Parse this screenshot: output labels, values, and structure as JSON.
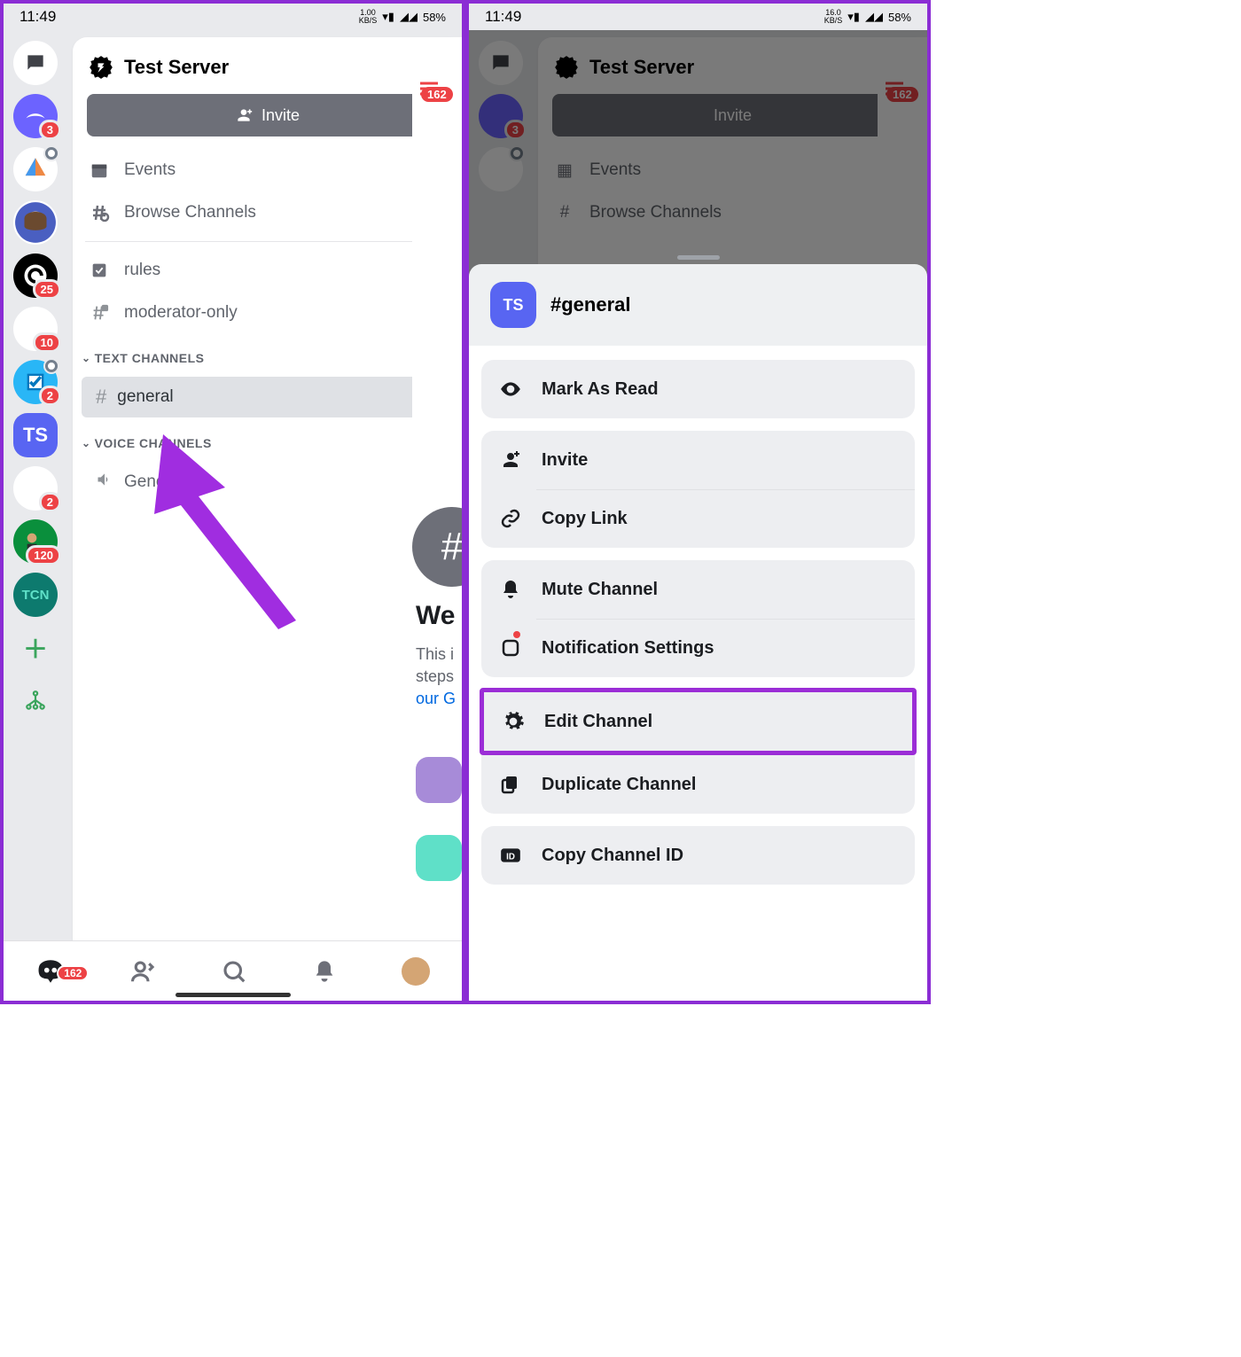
{
  "status": {
    "time": "11:49",
    "kbs_left": "1.00",
    "kbs_right": "16.0",
    "kbs_unit": "KB/S",
    "battery": "58%"
  },
  "server": {
    "name": "Test Server",
    "invite_label": "Invite",
    "rows": {
      "events": "Events",
      "browse": "Browse Channels",
      "rules": "rules",
      "mod": "moderator-only"
    },
    "categories": {
      "text": "TEXT CHANNELS",
      "voice": "VOICE CHANNELS"
    },
    "channels": {
      "general": "general",
      "general_voice": "General"
    }
  },
  "rail": {
    "ts_label": "TS",
    "badges": {
      "b1": "3",
      "b2": "25",
      "b3": "10",
      "b4": "2",
      "b5": "2",
      "b6": "120"
    }
  },
  "peek": {
    "badge": "162",
    "welcome": "We",
    "sub1": "This i",
    "sub2": "steps",
    "sub3": "our G"
  },
  "nav": {
    "badge": "162"
  },
  "sheet": {
    "server_short": "TS",
    "title": "#general",
    "options": {
      "mark_read": "Mark As Read",
      "invite": "Invite",
      "copy_link": "Copy Link",
      "mute": "Mute Channel",
      "notif": "Notification Settings",
      "edit": "Edit Channel",
      "duplicate": "Duplicate Channel",
      "copy_id": "Copy Channel ID"
    }
  }
}
